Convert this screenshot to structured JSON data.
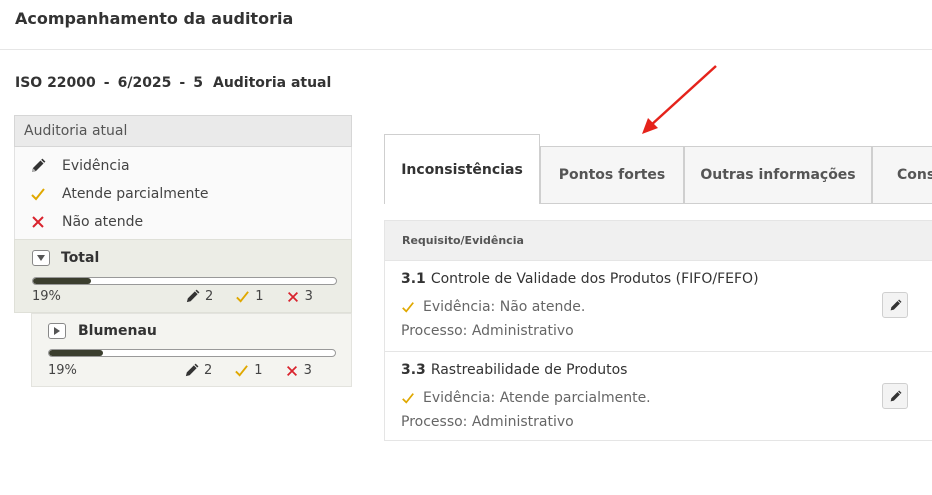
{
  "page_title": "Acompanhamento da auditoria",
  "audit": {
    "code": "ISO 22000",
    "period": "6/2025",
    "number": "5",
    "label": "Auditoria atual"
  },
  "panel": {
    "title": "Auditoria atual",
    "legend": [
      {
        "icon": "pencil-icon",
        "label": "Evidência"
      },
      {
        "icon": "check-icon",
        "label": "Atende parcialmente"
      },
      {
        "icon": "x-icon",
        "label": "Não atende"
      }
    ],
    "groups": [
      {
        "name": "Total",
        "expanded": true,
        "progress": 0.19,
        "percent_label": "19%",
        "evidence": "2",
        "partial": "1",
        "not_met": "3"
      },
      {
        "name": "Blumenau",
        "expanded": false,
        "progress": 0.19,
        "percent_label": "19%",
        "evidence": "2",
        "partial": "1",
        "not_met": "3"
      }
    ]
  },
  "tabs": [
    {
      "label": "Inconsistências",
      "active": true
    },
    {
      "label": "Pontos fortes",
      "active": false
    },
    {
      "label": "Outras informações",
      "active": false
    },
    {
      "label": "Cons",
      "active": false
    }
  ],
  "table": {
    "header": "Requisito/Evidência",
    "rows": [
      {
        "number": "3.1",
        "title": "Controle de Validade dos Produtos (FIFO/FEFO)",
        "evidence": "Evidência: Não atende.",
        "process": "Processo: Administrativo"
      },
      {
        "number": "3.3",
        "title": "Rastreabilidade de Produtos",
        "evidence": "Evidência: Atende parcialmente.",
        "process": "Processo: Administrativo"
      }
    ]
  },
  "colors": {
    "check": "#e0a800",
    "cross": "#d9232d",
    "arrow": "#e5231b",
    "progress": "#3b3e2e"
  }
}
